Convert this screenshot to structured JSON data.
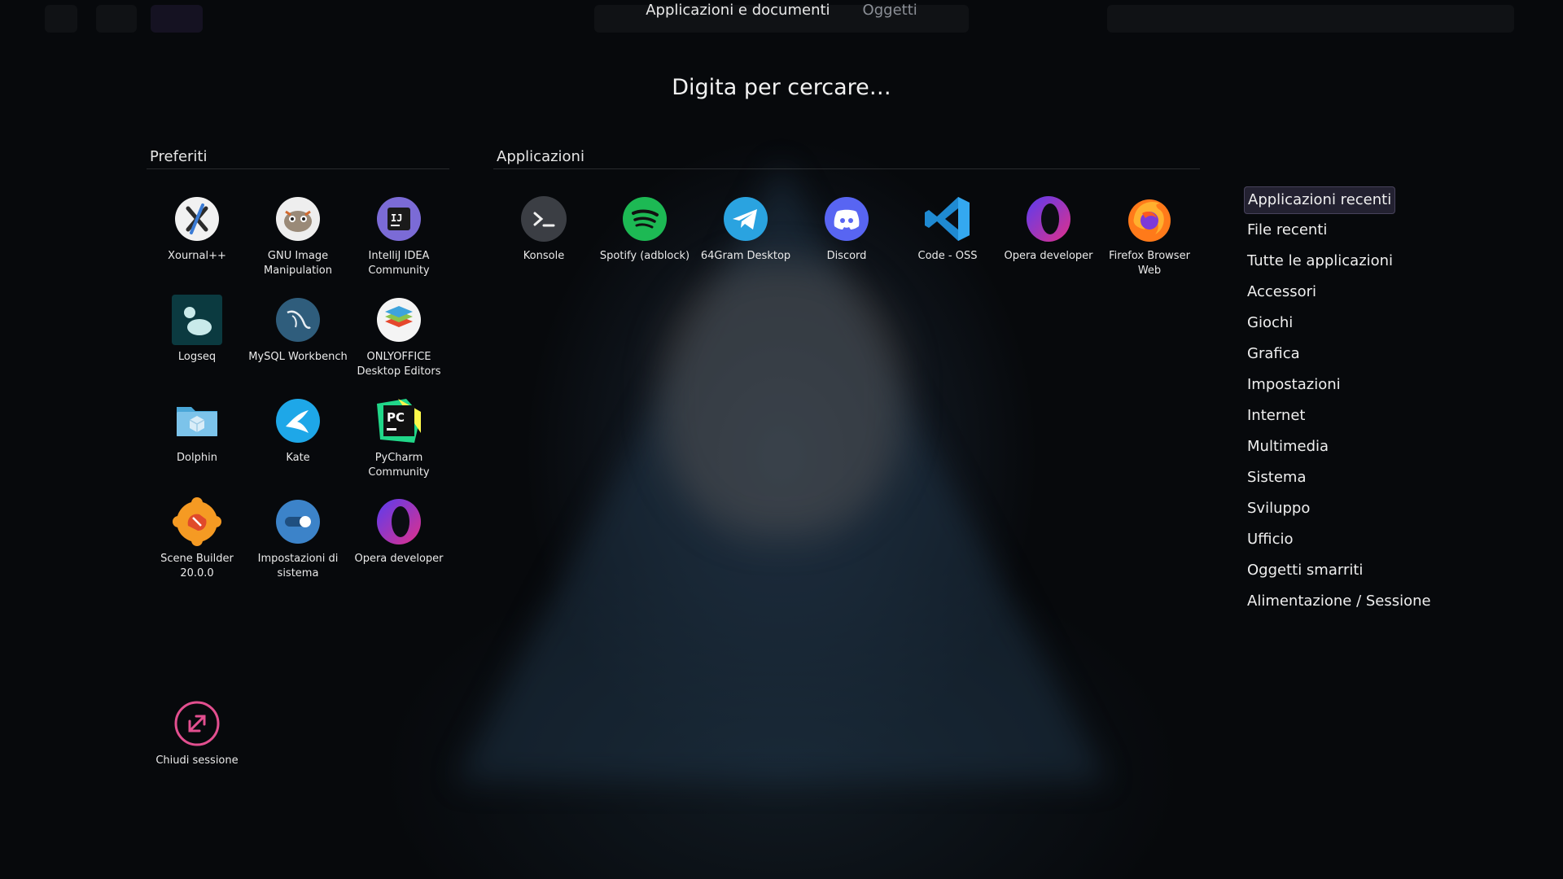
{
  "tabs": [
    {
      "label": "Applicazioni e documenti",
      "active": true
    },
    {
      "label": "Oggetti",
      "active": false
    }
  ],
  "search": {
    "placeholder": "Digita per cercare…"
  },
  "favorites": {
    "title": "Preferiti",
    "items": [
      {
        "label": "Xournal++",
        "icon": "xournal-icon"
      },
      {
        "label": "GNU Image Manipulation",
        "icon": "gimp-icon"
      },
      {
        "label": "IntelliJ IDEA Community",
        "icon": "intellij-icon"
      },
      {
        "label": "Logseq",
        "icon": "logseq-icon"
      },
      {
        "label": "MySQL Workbench",
        "icon": "mysql-workbench-icon"
      },
      {
        "label": "ONLYOFFICE Desktop Editors",
        "icon": "onlyoffice-icon"
      },
      {
        "label": "Dolphin",
        "icon": "dolphin-folder-icon"
      },
      {
        "label": "Kate",
        "icon": "kate-icon"
      },
      {
        "label": "PyCharm Community",
        "icon": "pycharm-icon"
      },
      {
        "label": "Scene Builder 20.0.0",
        "icon": "scene-builder-icon"
      },
      {
        "label": "Impostazioni di sistema",
        "icon": "system-settings-icon"
      },
      {
        "label": "Opera developer",
        "icon": "opera-icon"
      }
    ]
  },
  "applications": {
    "title": "Applicazioni",
    "items": [
      {
        "label": "Konsole",
        "icon": "konsole-icon"
      },
      {
        "label": "Spotify (adblock)",
        "icon": "spotify-icon"
      },
      {
        "label": "64Gram Desktop",
        "icon": "telegram-icon"
      },
      {
        "label": "Discord",
        "icon": "discord-icon"
      },
      {
        "label": "Code - OSS",
        "icon": "vscode-icon"
      },
      {
        "label": "Opera developer",
        "icon": "opera-icon"
      },
      {
        "label": "Firefox Browser Web",
        "icon": "firefox-icon"
      }
    ]
  },
  "session": {
    "label": "Chiudi sessione",
    "icon": "logout-icon"
  },
  "categories": [
    {
      "label": "Applicazioni recenti",
      "selected": true
    },
    {
      "label": "File recenti"
    },
    {
      "label": "Tutte le applicazioni"
    },
    {
      "label": "Accessori"
    },
    {
      "label": "Giochi"
    },
    {
      "label": "Grafica"
    },
    {
      "label": "Impostazioni"
    },
    {
      "label": "Internet"
    },
    {
      "label": "Multimedia"
    },
    {
      "label": "Sistema"
    },
    {
      "label": "Sviluppo"
    },
    {
      "label": "Ufficio"
    },
    {
      "label": "Oggetti smarriti"
    },
    {
      "label": "Alimentazione / Sessione"
    }
  ]
}
